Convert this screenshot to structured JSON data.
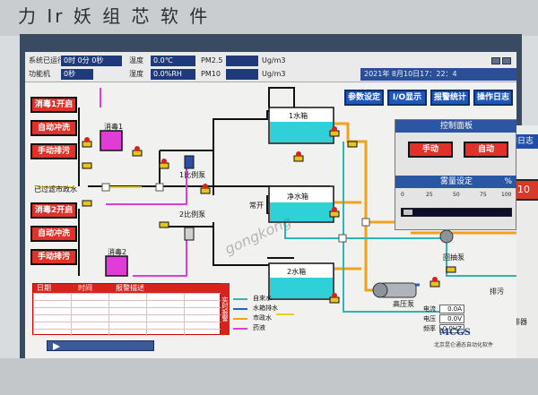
{
  "window_title_fragment": "力 Ir 妖 组 芯 软 件",
  "header": {
    "runtime_label": "系统已运行",
    "runtime_value": "0时 0分 0秒",
    "temp_label": "温度",
    "temp_value": "0.0℃",
    "pm25_label": "PM2.5",
    "pm25_unit": "Ug/m3",
    "row2_label": "功能机",
    "row2_value": "0秒",
    "humidity_label": "湿度",
    "humidity_value": "0.0%RH",
    "pm10_label": "PM10",
    "pm10_unit": "Ug/m3",
    "datetime": "2021年 8月10日17：22：4"
  },
  "top_buttons": [
    "参数设定",
    "I/O显示",
    "报警统计",
    "操作日志"
  ],
  "left_buttons": {
    "group1": [
      "消毒1开启",
      "自动冲洗",
      "手动排污"
    ],
    "group2": [
      "消毒2开启",
      "自动冲洗",
      "手动排污"
    ]
  },
  "labels": {
    "disinfect1": "消毒1",
    "disinfect2": "消毒2",
    "pump1": "1比例泵",
    "pump2": "2比例泵",
    "tank1": "1水箱",
    "tank_clean": "净水箱",
    "tank2": "2水箱",
    "inlet": "已过滤市政水",
    "open": "常开",
    "backwash_pump": "回抽泵",
    "high_pump": "高压泵",
    "drain": "排污",
    "side_label": "剂排器"
  },
  "meters": [
    {
      "label": "电流",
      "value": "0.0A"
    },
    {
      "label": "电压",
      "value": "0.0V"
    },
    {
      "label": "频率",
      "value": "0.0HZ"
    }
  ],
  "control_panel": {
    "title": "控制面板",
    "manual": "手动",
    "auto": "自动",
    "spray_title": "雾量设定",
    "spray_unit": "%",
    "scale": [
      "0",
      "25",
      "50",
      "75",
      "100"
    ]
  },
  "alarm": {
    "cols": [
      "日期",
      "时间",
      "报警描述"
    ],
    "side": "实时报警"
  },
  "legend": [
    "自来水",
    "水箱排水",
    "市政水",
    "药液"
  ],
  "brand": {
    "name": "MCGS",
    "sub": "北京昆仑通态自动化软件"
  },
  "win2": {
    "title": "作日志",
    "button": "10"
  },
  "watermark": "gongkong",
  "colors": {
    "accent_blue": "#1e57b8",
    "button_red": "#e0322a",
    "tank_cyan": "#2fd0d8",
    "disinfect_magenta": "#e03cd8",
    "pipe_orange": "#f0a11e",
    "pipe_teal": "#2bb7b3"
  }
}
